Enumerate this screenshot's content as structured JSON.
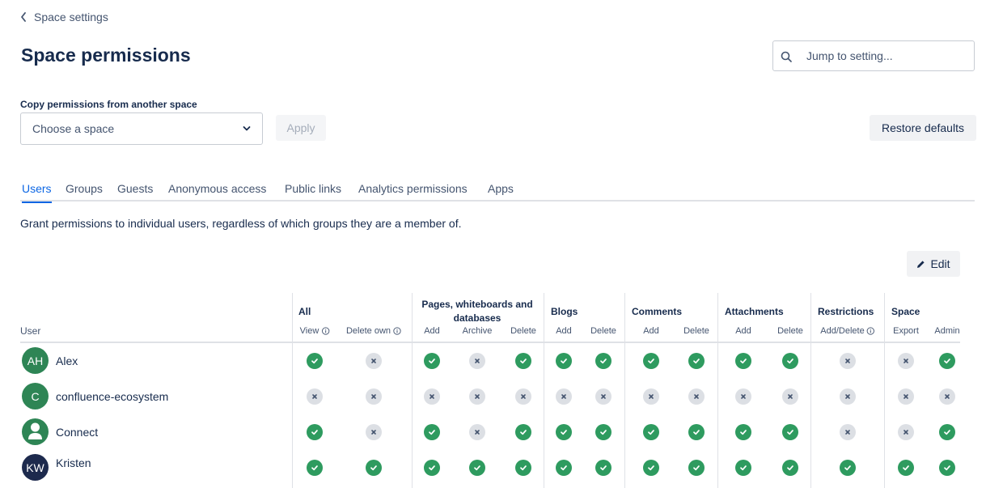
{
  "header": {
    "back_label": "Space settings",
    "title": "Space permissions",
    "jump_placeholder": "Jump to setting..."
  },
  "copy": {
    "label": "Copy permissions from another space",
    "select_placeholder": "Choose a space",
    "apply_label": "Apply",
    "restore_label": "Restore defaults"
  },
  "tabs": [
    {
      "label": "Users",
      "active": true
    },
    {
      "label": "Groups",
      "active": false
    },
    {
      "label": "Guests",
      "active": false
    },
    {
      "label": "Anonymous access",
      "active": false
    },
    {
      "label": "Public links",
      "active": false
    },
    {
      "label": "Analytics permissions",
      "active": false
    },
    {
      "label": "Apps",
      "active": false
    }
  ],
  "description": "Grant permissions to individual users, regardless of which groups they are a member of.",
  "edit_label": "Edit",
  "table": {
    "user_header": "User",
    "groups": [
      {
        "name": "All",
        "columns": [
          {
            "label": "View",
            "info": true
          },
          {
            "label": "Delete own",
            "info": true
          }
        ]
      },
      {
        "name": "Pages, whiteboards and databases",
        "columns": [
          {
            "label": "Add"
          },
          {
            "label": "Archive"
          },
          {
            "label": "Delete"
          }
        ]
      },
      {
        "name": "Blogs",
        "columns": [
          {
            "label": "Add"
          },
          {
            "label": "Delete"
          }
        ]
      },
      {
        "name": "Comments",
        "columns": [
          {
            "label": "Add"
          },
          {
            "label": "Delete"
          }
        ]
      },
      {
        "name": "Attachments",
        "columns": [
          {
            "label": "Add"
          },
          {
            "label": "Delete"
          }
        ]
      },
      {
        "name": "Restrictions",
        "columns": [
          {
            "label": "Add/Delete",
            "info": true
          }
        ]
      },
      {
        "name": "Space",
        "columns": [
          {
            "label": "Export"
          },
          {
            "label": "Admin"
          }
        ]
      }
    ],
    "rows": [
      {
        "initials": "AH",
        "name": "Alex",
        "avatar_color": "#2e8555",
        "avatar_type": "initials",
        "perms": [
          true,
          false,
          true,
          false,
          true,
          true,
          true,
          true,
          true,
          true,
          true,
          false,
          false,
          true
        ]
      },
      {
        "initials": "C",
        "name": "confluence-ecosystem",
        "avatar_color": "#2e8555",
        "avatar_type": "initials",
        "perms": [
          false,
          false,
          false,
          false,
          false,
          false,
          false,
          false,
          false,
          false,
          false,
          false,
          false,
          false
        ]
      },
      {
        "initials": "",
        "name": "Connect",
        "avatar_color": "#2e8555",
        "avatar_type": "person-icon",
        "perms": [
          true,
          false,
          true,
          false,
          true,
          true,
          true,
          true,
          true,
          true,
          true,
          false,
          false,
          true
        ]
      },
      {
        "initials": "KW",
        "name": "Kristen",
        "avatar_color": "#1d2a4d",
        "avatar_type": "initials",
        "perms": [
          true,
          true,
          true,
          true,
          true,
          true,
          true,
          true,
          true,
          true,
          true,
          true,
          true,
          true
        ]
      }
    ]
  },
  "colors": {
    "accent": "#0c66e4",
    "granted": "#2e9b5f",
    "denied": "#dcdfe4"
  }
}
